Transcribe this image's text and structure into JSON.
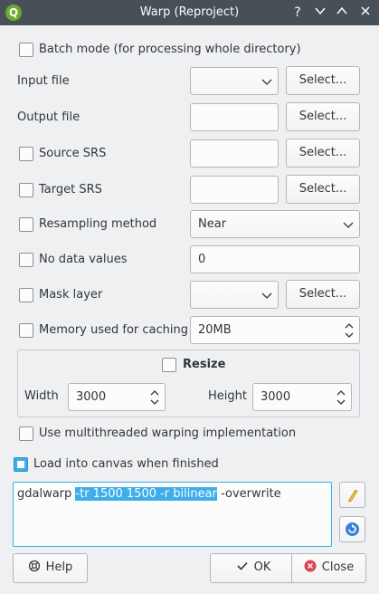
{
  "window": {
    "title": "Warp (Reproject)",
    "buttons": {
      "help": "?",
      "minimize": "∨",
      "maximize": "∧",
      "close": "✕"
    },
    "app_icon": "Q"
  },
  "batch": {
    "label": "Batch mode (for processing whole directory)",
    "checked": false
  },
  "input_file": {
    "label": "Input file",
    "value": "",
    "select_label": "Select..."
  },
  "output_file": {
    "label": "Output file",
    "value": "",
    "select_label": "Select..."
  },
  "source_srs": {
    "label": "Source SRS",
    "value": "",
    "select_label": "Select..."
  },
  "target_srs": {
    "label": "Target SRS",
    "value": "",
    "select_label": "Select..."
  },
  "resampling": {
    "label": "Resampling method",
    "value": "Near"
  },
  "nodata": {
    "label": "No data values",
    "value": "0"
  },
  "mask": {
    "label": "Mask layer",
    "value": "",
    "select_label": "Select..."
  },
  "memory": {
    "label": "Memory used for caching",
    "value": "20MB"
  },
  "resize": {
    "label": "Resize",
    "width_label": "Width",
    "width_value": "3000",
    "height_label": "Height",
    "height_value": "3000"
  },
  "multithread": {
    "label": "Use multithreaded warping implementation"
  },
  "load_canvas": {
    "label": "Load into canvas when finished",
    "checked": true
  },
  "command": {
    "prefix": "gdalwarp ",
    "selected": "-tr 1500 1500 -r bilinear",
    "suffix": " -overwrite"
  },
  "footer": {
    "help": "Help",
    "ok": "OK",
    "close": "Close"
  },
  "colors": {
    "accent": "#3daee9",
    "titlebar": "#475057",
    "close_icon": "#da4453",
    "edit_icon": "#f6c342"
  }
}
